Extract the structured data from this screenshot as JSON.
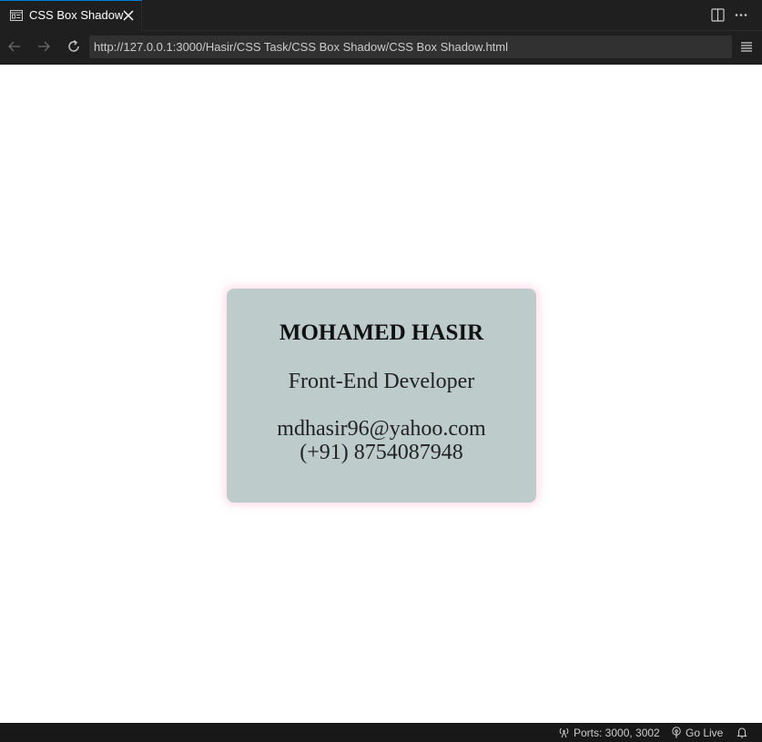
{
  "tab": {
    "title": "CSS Box Shadow",
    "icon": "preview-icon",
    "close_icon": "close-icon"
  },
  "toolbar": {
    "split_icon": "split-editor-icon",
    "more_icon": "more-actions-icon"
  },
  "nav": {
    "back_icon": "arrow-left-icon",
    "forward_icon": "arrow-right-icon",
    "reload_icon": "reload-icon",
    "url": "http://127.0.0.1:3000/Hasir/CSS Task/CSS Box Shadow/CSS Box Shadow.html",
    "menu_icon": "hamburger-menu-icon"
  },
  "card": {
    "name": "MOHAMED HASIR",
    "role": "Front-End Developer",
    "email": "mdhasir96@yahoo.com",
    "phone": "(+91) 8754087948",
    "background": "#bdcbcb",
    "shadow_color": "#ffb6cd"
  },
  "status": {
    "ports": "Ports: 3000, 3002",
    "go_live": "Go Live",
    "ports_icon": "broadcast-icon",
    "go_live_icon": "broadcast-live-icon",
    "bell_icon": "bell-icon"
  },
  "colors": {
    "chrome_bg": "#1f1f1f",
    "url_bg": "#313131",
    "page_bg": "#ffffff",
    "accent": "#0078d4"
  }
}
